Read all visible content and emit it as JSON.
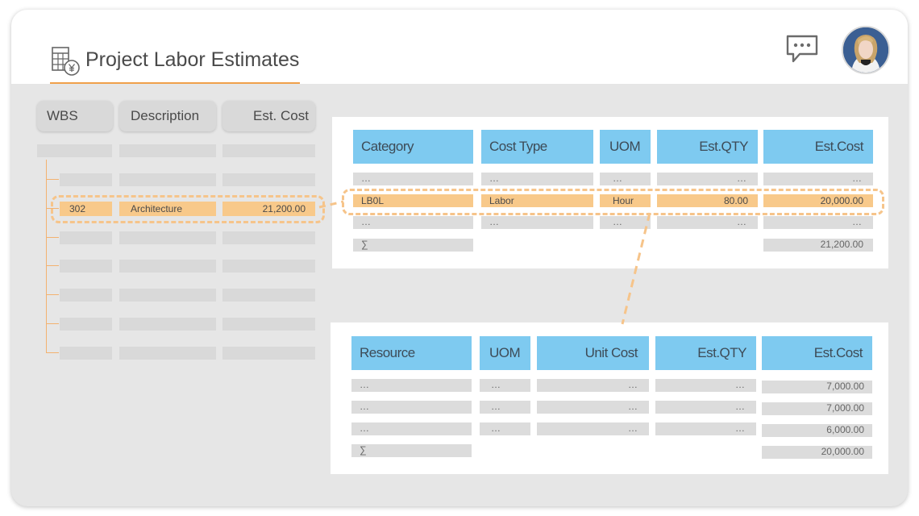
{
  "header": {
    "title": "Project Labor Estimates",
    "title_icon": "calculator-yen-icon",
    "chat_icon": "chat-icon",
    "avatar": "user-avatar"
  },
  "wbs_table": {
    "columns": [
      "WBS",
      "Description",
      "Est. Cost"
    ],
    "selected_row": {
      "wbs": "302",
      "description": "Architecture",
      "est_cost": "21,200.00"
    }
  },
  "category_table": {
    "columns": [
      "Category",
      "Cost Type",
      "UOM",
      "Est.QTY",
      "Est.Cost"
    ],
    "ellipsis": "…",
    "selected_row": {
      "category": "LB0L",
      "cost_type": "Labor",
      "uom": "Hour",
      "est_qty": "80.00",
      "est_cost": "20,000.00"
    },
    "sum_symbol": "∑",
    "total": "21,200.00"
  },
  "resource_table": {
    "columns": [
      "Resource",
      "UOM",
      "Unit Cost",
      "Est.QTY",
      "Est.Cost"
    ],
    "ellipsis": "…",
    "rows": [
      {
        "est_cost": "7,000.00"
      },
      {
        "est_cost": "7,000.00"
      },
      {
        "est_cost": "6,000.00"
      }
    ],
    "sum_symbol": "∑",
    "total": "20,000.00"
  },
  "colors": {
    "header_blue": "#7ecaf0",
    "highlight_orange": "#f8c98a",
    "accent_orange": "#f0a04a",
    "background": "#e6e6e6"
  }
}
